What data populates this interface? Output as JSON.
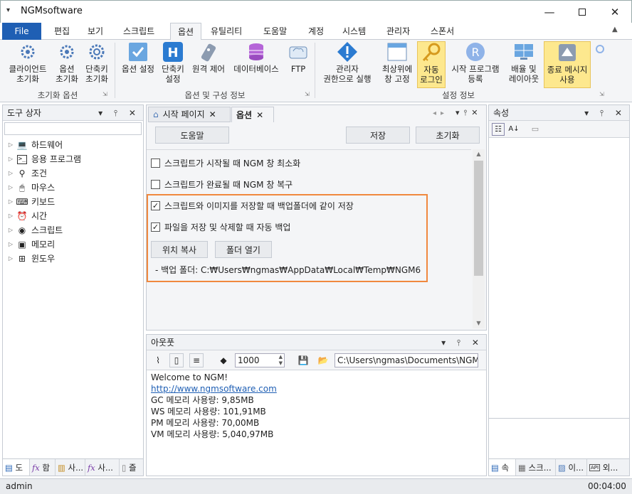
{
  "window": {
    "app_title": "NGMsoftware",
    "qa": "▾"
  },
  "menu": {
    "file": "File",
    "tabs": [
      "편집",
      "보기",
      "스크립트",
      "옵션",
      "유틸리티",
      "도움말",
      "계정",
      "시스템",
      "관리자",
      "스폰서"
    ]
  },
  "ribbon": {
    "group1": {
      "name": "초기화 옵션",
      "buttons": [
        "클라이언트\n초기화",
        "옵션\n초기화",
        "단축키\n초기화"
      ]
    },
    "group2": {
      "name": "옵션 및 구성 정보",
      "buttons": [
        "옵션 설정",
        "단축키\n설정",
        "원격 제어",
        "데이터베이스",
        "FTP"
      ]
    },
    "group3": {
      "name": "설정 정보",
      "buttons": [
        "관리자\n권한으로 실행",
        "최상위에\n창 고정",
        "자동\n로그인",
        "시작 프로그램\n등록",
        "배율 및\n레이아웃",
        "종료 메시지\n사용"
      ]
    }
  },
  "toolbox": {
    "title": "도구 상자",
    "items": [
      "하드웨어",
      "응용 프로그램",
      "조건",
      "마우스",
      "키보드",
      "시간",
      "스크립트",
      "메모리",
      "윈도우"
    ],
    "tabs": [
      "도",
      "함",
      "사...",
      "사...",
      "즐"
    ]
  },
  "document": {
    "tabs": [
      "시작 페이지",
      "옵션"
    ],
    "buttons": {
      "help": "도움말",
      "save": "저장",
      "reset": "초기화"
    },
    "options": [
      {
        "label": "스크립트가 시작될 때 NGM 창 최소화",
        "checked": false
      },
      {
        "label": "스크립트가 완료될 때 NGM 창 복구",
        "checked": false
      },
      {
        "label": "스크립트와 이미지를 저장할 때 백업폴더에 같이 저장",
        "checked": true
      },
      {
        "label": "파일을 저장 및 삭제할 때 자동 백업",
        "checked": true
      }
    ],
    "copy_location": "위치 복사",
    "open_folder": "폴더 열기",
    "backup_folder": "- 백업 폴더: C:₩Users₩ngmas₩AppData₩Local₩Temp₩NGM6"
  },
  "output": {
    "title": "아웃풋",
    "count": "1000",
    "path": "C:\\Users\\ngmas\\Documents\\NGM6\\",
    "lines": [
      "Welcome to NGM!",
      "http://www.ngmsoftware.com",
      "GC 메모리 사용량: 9,85MB",
      "WS 메모리 사용량: 101,91MB",
      "PM 메모리 사용량: 70,00MB",
      "VM 메모리 사용량: 5,040,97MB"
    ]
  },
  "properties": {
    "title": "속성",
    "tabs": [
      "속",
      "스크...",
      "이...",
      "외..."
    ],
    "api_label": "API"
  },
  "status": {
    "user": "admin",
    "time": "00:04:00"
  },
  "colors": {
    "accent": "#1f5fb4",
    "highlight": "#fde88e",
    "focus_border": "#f0883e"
  }
}
